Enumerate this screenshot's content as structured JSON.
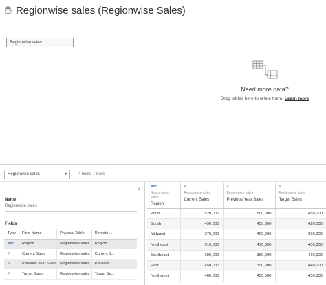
{
  "header": {
    "icon": "datasource-cylinder-icon",
    "title": "Regionwise sales (Regionwise Sales)"
  },
  "canvas": {
    "table_pill": "Regionwise sales",
    "empty_state": {
      "icon": "relate-tables-icon",
      "title": "Need more data?",
      "subtitle": "Drag tables here to relate them.",
      "link": "Learn more"
    }
  },
  "toolbar": {
    "table_select": "Regionwise sales",
    "summary": "4 fields 7 rows"
  },
  "metadata": {
    "collapse_glyph": "‹",
    "name_label": "Name",
    "name_value": "Regionwise sales",
    "fields_label": "Fields",
    "columns": [
      "Type",
      "Field Name",
      "Physical Table",
      "Remote ..."
    ],
    "rows": [
      {
        "type": "Abc",
        "field": "Region",
        "table": "Regionwise sales",
        "remote": "Region"
      },
      {
        "type": "#",
        "field": "Current Sales",
        "table": "Regionwise sales",
        "remote": "Current S..."
      },
      {
        "type": "#",
        "field": "Previous Year Sales",
        "table": "Regionwise sales",
        "remote": "Previous ..."
      },
      {
        "type": "#",
        "field": "Target Sales",
        "table": "Regionwise sales",
        "remote": "Target Sa..."
      }
    ]
  },
  "grid": {
    "columns": [
      {
        "type": "Abc",
        "source": "Regionwise sales",
        "name": "Region"
      },
      {
        "type": "#",
        "source": "Regionwise sales",
        "name": "Current Sales"
      },
      {
        "type": "#",
        "source": "Regionwise sales",
        "name": "Previous Year Sales"
      },
      {
        "type": "#",
        "source": "Regionwise sales",
        "name": "Target Sales"
      }
    ],
    "rows": [
      [
        "West",
        "520,000",
        "500,000",
        "450,000"
      ],
      [
        "South",
        "490,000",
        "450,000",
        "420,000"
      ],
      [
        "Midwest",
        "370,000",
        "400,000",
        "390,000"
      ],
      [
        "Northeast",
        "510,000",
        "470,000",
        "450,000"
      ],
      [
        "Southeast",
        "390,000",
        "380,000",
        "410,000"
      ],
      [
        "East",
        "450,000",
        "390,000",
        "440,000"
      ],
      [
        "Northwest",
        "460,000",
        "450,000",
        "450,000"
      ]
    ]
  }
}
